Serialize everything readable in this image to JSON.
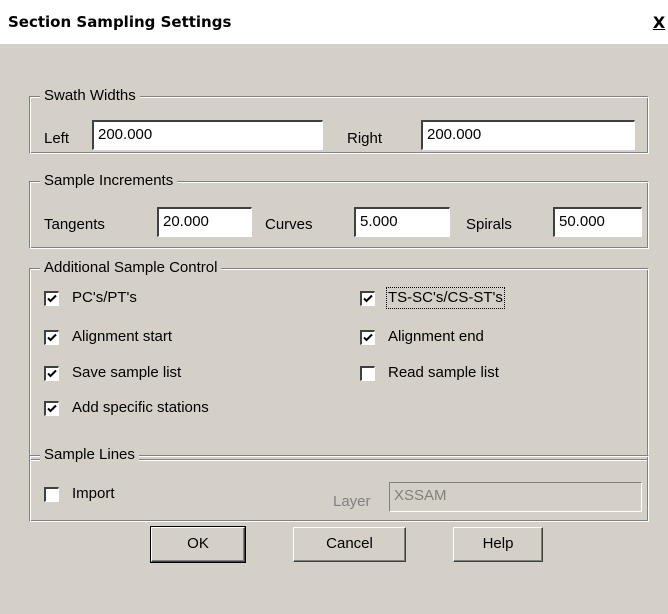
{
  "window": {
    "title": "Section Sampling Settings",
    "close_label": "X"
  },
  "swath": {
    "legend": "Swath Widths",
    "left_label": "Left",
    "left_value": "200.000",
    "right_label": "Right",
    "right_value": "200.000"
  },
  "increments": {
    "legend": "Sample Increments",
    "tangents_label": "Tangents",
    "tangents_value": "20.000",
    "curves_label": "Curves",
    "curves_value": "5.000",
    "spirals_label": "Spirals",
    "spirals_value": "50.000"
  },
  "control": {
    "legend": "Additional Sample Control",
    "items": [
      {
        "label": "PC's/PT's",
        "checked": true
      },
      {
        "label": "TS-SC's/CS-ST's",
        "checked": true
      },
      {
        "label": "Alignment start",
        "checked": true
      },
      {
        "label": "Alignment end",
        "checked": true
      },
      {
        "label": "Save sample list",
        "checked": true
      },
      {
        "label": "Read sample list",
        "checked": false
      },
      {
        "label": "Add specific stations",
        "checked": true
      }
    ]
  },
  "lines": {
    "legend": "Sample Lines",
    "import_label": "Import",
    "import_checked": false,
    "layer_label": "Layer",
    "layer_value": "XSSAM"
  },
  "buttons": {
    "ok": "OK",
    "cancel": "Cancel",
    "help": "Help"
  }
}
